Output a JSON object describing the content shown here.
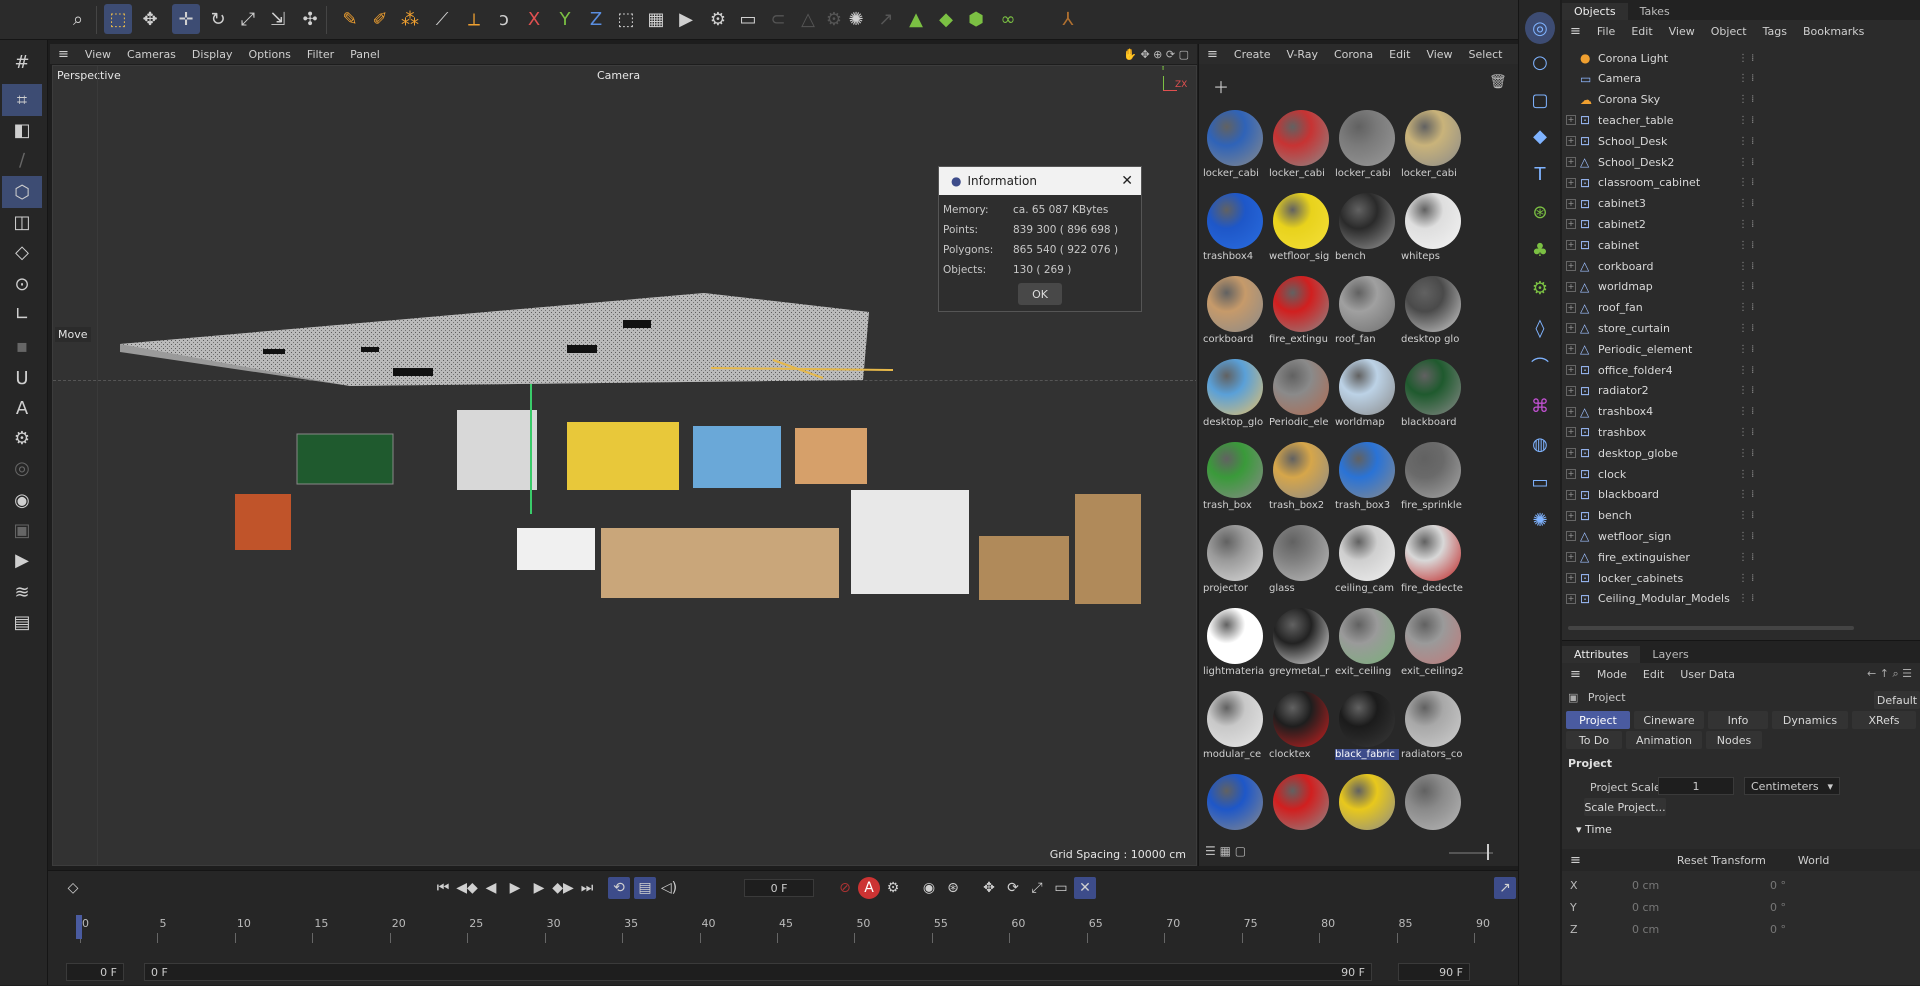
{
  "viewport": {
    "menu": [
      "View",
      "Cameras",
      "Display",
      "Options",
      "Filter",
      "Panel"
    ],
    "projection": "Perspective",
    "camera": "Camera",
    "move_label": "Move",
    "grid_spacing": "Grid Spacing : 10000 cm",
    "axis_y": "Y",
    "axis_zx": "ZX"
  },
  "info_dialog": {
    "title": "Information",
    "rows": [
      {
        "label": "Memory:",
        "value": "ca. 65 087 KBytes"
      },
      {
        "label": "Points:",
        "value": "839 300 ( 896 698 )"
      },
      {
        "label": "Polygons:",
        "value": "865 540 ( 922 076 )"
      },
      {
        "label": "Objects:",
        "value": "130 ( 269 )"
      }
    ],
    "ok": "OK"
  },
  "materials": {
    "menu": [
      "Create",
      "V-Ray",
      "Corona",
      "Edit",
      "View",
      "Select"
    ],
    "items": [
      {
        "name": "locker_cabi",
        "c1": "#2f63b8",
        "c2": "#8a8a8a"
      },
      {
        "name": "locker_cabi",
        "c1": "#c73333",
        "c2": "#8a8a8a"
      },
      {
        "name": "locker_cabi",
        "c1": "#7a7a7a",
        "c2": "#9a9a9a"
      },
      {
        "name": "locker_cabi",
        "c1": "#c9b37a",
        "c2": "#8a8a8a"
      },
      {
        "name": "trashbox4",
        "c1": "#1e57c8",
        "c2": "#2a6de0"
      },
      {
        "name": "wetfloor_sig",
        "c1": "#e8d21c",
        "c2": "#f5e03a"
      },
      {
        "name": "bench",
        "c1": "#2a2a2a",
        "c2": "#9a9a9a"
      },
      {
        "name": "whiteps",
        "c1": "#dedede",
        "c2": "#f4f4f4"
      },
      {
        "name": "corkboard",
        "c1": "#c69a6a",
        "c2": "#8a8a8a"
      },
      {
        "name": "fire_extingu",
        "c1": "#d11f1f",
        "c2": "#8a8a8a"
      },
      {
        "name": "roof_fan",
        "c1": "#a0a0a0",
        "c2": "#6e6e6e"
      },
      {
        "name": "desktop glo",
        "c1": "#4a4a4a",
        "c2": "#cfcfcf"
      },
      {
        "name": "desktop_glo",
        "c1": "#5aa0d8",
        "c2": "#e6c06a"
      },
      {
        "name": "Periodic_ele",
        "c1": "#8a8a8a",
        "c2": "#b06a50"
      },
      {
        "name": "worldmap",
        "c1": "#bcd2e6",
        "c2": "#8a8a8a"
      },
      {
        "name": "blackboard",
        "c1": "#1f5a2e",
        "c2": "#8a8a8a"
      },
      {
        "name": "trash_box",
        "c1": "#3a9a3a",
        "c2": "#8a8a8a"
      },
      {
        "name": "trash_box2",
        "c1": "#d6a64a",
        "c2": "#8a8a8a"
      },
      {
        "name": "trash_box3",
        "c1": "#2a73d6",
        "c2": "#8a8a8a"
      },
      {
        "name": "fire_sprinkle",
        "c1": "#6a6a6a",
        "c2": "#a8a8a8"
      },
      {
        "name": "projector",
        "c1": "#9a9a9a",
        "c2": "#dcdcdc"
      },
      {
        "name": "glass",
        "c1": "#7f7f7f",
        "c2": "#bdbdbd"
      },
      {
        "name": "ceiling_cam",
        "c1": "#cfcfcf",
        "c2": "#f0f0f0"
      },
      {
        "name": "fire_dedecte",
        "c1": "#d8d8d8",
        "c2": "#c02020"
      },
      {
        "name": "lightmateria",
        "c1": "#ffffff",
        "c2": "#ffffff"
      },
      {
        "name": "greymetal_r",
        "c1": "#222222",
        "c2": "#e8e8e8"
      },
      {
        "name": "exit_ceiling",
        "c1": "#9a9a9a",
        "c2": "#7ab07a"
      },
      {
        "name": "exit_ceiling2",
        "c1": "#9a9a9a",
        "c2": "#c07a7a"
      },
      {
        "name": "modular_ce",
        "c1": "#c8c8c8",
        "c2": "#e8e8e8"
      },
      {
        "name": "clocktex",
        "c1": "#1e1e1e",
        "c2": "#d02020"
      },
      {
        "name": "black_fabric",
        "c1": "#1b1b1b",
        "c2": "#3a3a3a"
      },
      {
        "name": "radiators_co",
        "c1": "#a8a8a8",
        "c2": "#cfcfcf"
      },
      {
        "name": "",
        "c1": "#1e57c8",
        "c2": "#8a8a8a"
      },
      {
        "name": "",
        "c1": "#d11f1f",
        "c2": "#8a8a8a"
      },
      {
        "name": "",
        "c1": "#e8c81c",
        "c2": "#8a8a8a"
      },
      {
        "name": "",
        "c1": "#8a8a8a",
        "c2": "#b8b8b8"
      }
    ],
    "selected_index": 30
  },
  "objects": {
    "tabs": [
      "Objects",
      "Takes"
    ],
    "menu": [
      "File",
      "Edit",
      "View",
      "Object",
      "Tags",
      "Bookmarks"
    ],
    "rows": [
      {
        "name": "Corona Light",
        "icon": "light",
        "expand": false
      },
      {
        "name": "Camera",
        "icon": "camera",
        "expand": false
      },
      {
        "name": "Corona Sky",
        "icon": "sky",
        "expand": false
      },
      {
        "name": "teacher_table",
        "icon": "null",
        "expand": true
      },
      {
        "name": "School_Desk",
        "icon": "null",
        "expand": true
      },
      {
        "name": "School_Desk2",
        "icon": "mesh",
        "expand": true
      },
      {
        "name": "classroom_cabinet",
        "icon": "null",
        "expand": true
      },
      {
        "name": "cabinet3",
        "icon": "null",
        "expand": true
      },
      {
        "name": "cabinet2",
        "icon": "null",
        "expand": true
      },
      {
        "name": "cabinet",
        "icon": "null",
        "expand": true
      },
      {
        "name": "corkboard",
        "icon": "mesh",
        "expand": true
      },
      {
        "name": "worldmap",
        "icon": "mesh",
        "expand": true
      },
      {
        "name": "roof_fan",
        "icon": "mesh",
        "expand": true
      },
      {
        "name": "store_curtain",
        "icon": "mesh",
        "expand": true
      },
      {
        "name": "Periodic_element",
        "icon": "mesh",
        "expand": true
      },
      {
        "name": "office_folder4",
        "icon": "null",
        "expand": true
      },
      {
        "name": "radiator2",
        "icon": "null",
        "expand": true
      },
      {
        "name": "trashbox4",
        "icon": "mesh",
        "expand": true
      },
      {
        "name": "trashbox",
        "icon": "null",
        "expand": true
      },
      {
        "name": "desktop_globe",
        "icon": "null",
        "expand": true
      },
      {
        "name": "clock",
        "icon": "null",
        "expand": true
      },
      {
        "name": "blackboard",
        "icon": "null",
        "expand": true
      },
      {
        "name": "bench",
        "icon": "null",
        "expand": true
      },
      {
        "name": "wetfloor_sign",
        "icon": "mesh",
        "expand": true
      },
      {
        "name": "fire_extinguisher",
        "icon": "mesh",
        "expand": true
      },
      {
        "name": "locker_cabinets",
        "icon": "null",
        "expand": true
      },
      {
        "name": "Ceiling_Modular_Models",
        "icon": "null",
        "expand": true
      }
    ]
  },
  "attributes": {
    "tabs": [
      "Attributes",
      "Layers"
    ],
    "menu": [
      "Mode",
      "Edit",
      "User Data"
    ],
    "object": "Project",
    "preset": "Default",
    "subtabs": [
      "Project",
      "Cineware",
      "Info",
      "Dynamics",
      "XRefs"
    ],
    "subtabs2": [
      "To Do",
      "Animation",
      "Nodes"
    ],
    "section": "Project",
    "scale_label": "Project Scale",
    "scale_value": "1",
    "scale_unit": "Centimeters",
    "scale_button": "Scale Project...",
    "time_section": "Time"
  },
  "coords": {
    "reset": "Reset Transform",
    "space": "World",
    "rows": [
      {
        "axis": "X",
        "pos": "0 cm",
        "rot": "0 °"
      },
      {
        "axis": "Y",
        "pos": "0 cm",
        "rot": "0 °"
      },
      {
        "axis": "Z",
        "pos": "0 cm",
        "rot": "0 °"
      }
    ]
  },
  "timeline": {
    "current_frame": "0 F",
    "ticks": [
      "0",
      "5",
      "10",
      "15",
      "20",
      "25",
      "30",
      "35",
      "40",
      "45",
      "50",
      "55",
      "60",
      "65",
      "70",
      "75",
      "80",
      "85",
      "90"
    ],
    "start": "0 F",
    "start2": "0 F",
    "end": "90 F",
    "end2": "90 F"
  }
}
